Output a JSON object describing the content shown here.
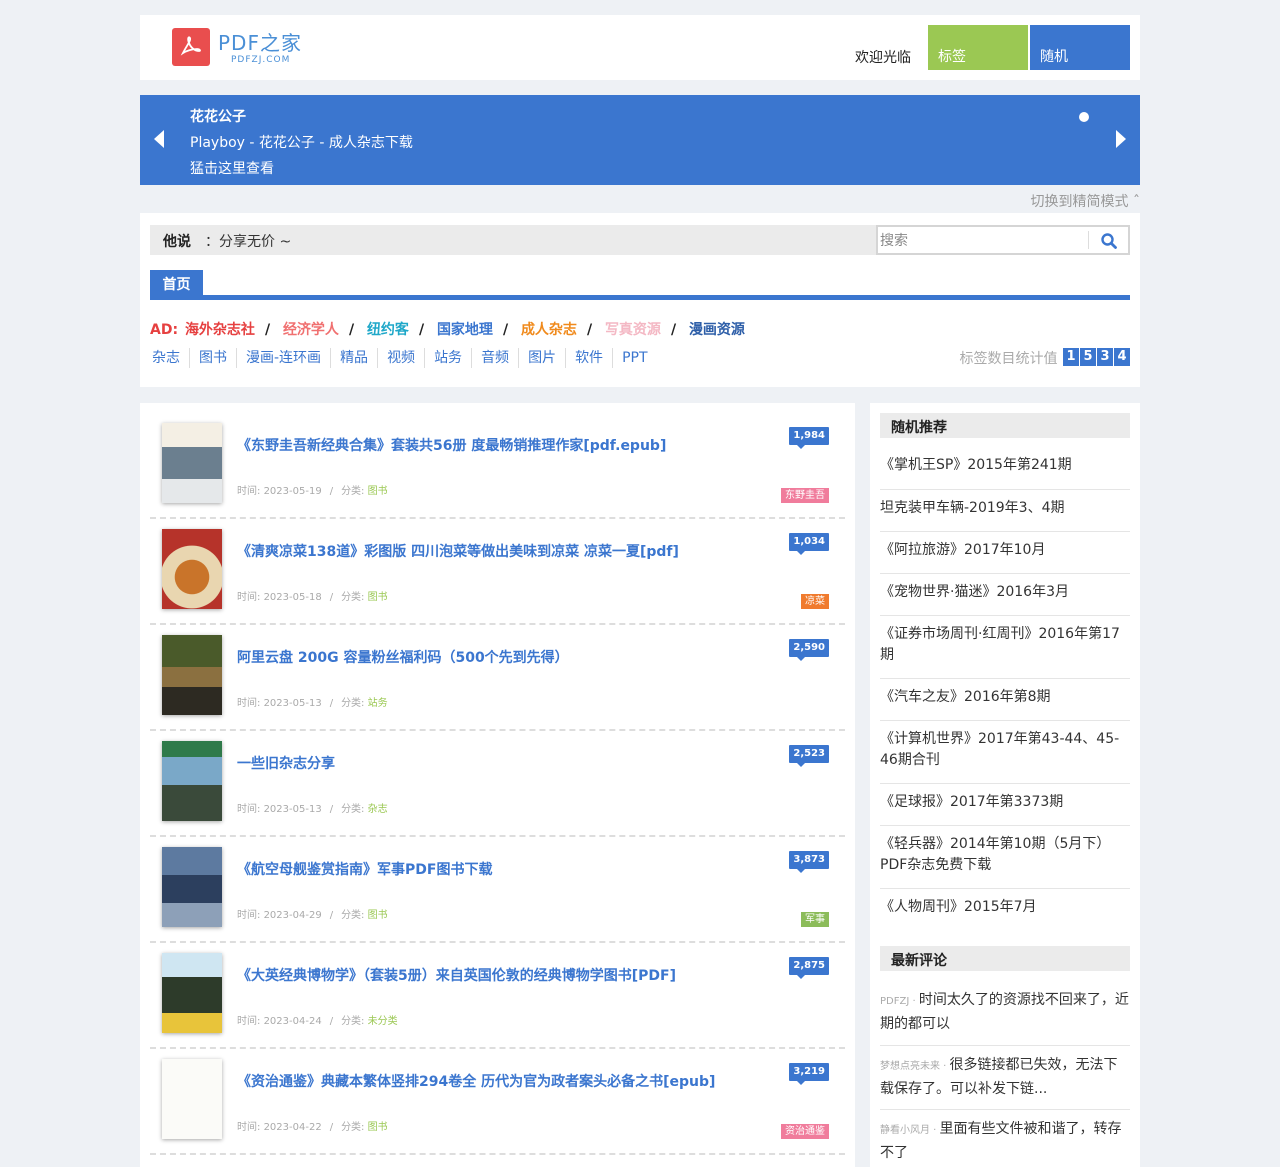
{
  "header": {
    "logo_text": "PDF之家",
    "logo_sub": "PDFZJ.COM",
    "welcome": "欢迎光临",
    "nav_tags": "标签",
    "nav_random": "随机"
  },
  "banner": {
    "title": "花花公子",
    "line2": "Playboy - 花花公子 - 成人杂志下载",
    "line3": "猛击这里查看"
  },
  "switch_mode": "切换到精简模式 ˆ",
  "say": {
    "label": "他说",
    "text": "：分享无价 ~"
  },
  "search": {
    "placeholder": "搜索"
  },
  "tab_home": "首页",
  "ad": {
    "prefix": "AD:",
    "items": [
      {
        "label": "海外杂志社",
        "color": "#e64040"
      },
      {
        "label": "经济学人",
        "color": "#f07070"
      },
      {
        "label": "纽约客",
        "color": "#1fa8c9"
      },
      {
        "label": "国家地理",
        "color": "#3b76cf"
      },
      {
        "label": "成人杂志",
        "color": "#f08a1c"
      },
      {
        "label": "写真资源",
        "color": "#f4b8c4"
      },
      {
        "label": "漫画资源",
        "color": "#2d5ea8"
      }
    ],
    "sep": "/"
  },
  "categories": [
    "杂志",
    "图书",
    "漫画-连环画",
    "精品",
    "视频",
    "站务",
    "音频",
    "图片",
    "软件",
    "PPT"
  ],
  "stat": {
    "label": "标签数目统计值",
    "digits": [
      "1",
      "5",
      "3",
      "4"
    ]
  },
  "articles": [
    {
      "title": "《东野圭吾新经典合集》套装共56册 度最畅销推理作家[pdf.epub]",
      "date": "2023-05-19",
      "category": "图书",
      "views": "1,984",
      "tag": "东野圭吾",
      "tag_color": "#f07c9c"
    },
    {
      "title": "《清爽凉菜138道》彩图版 四川泡菜等做出美味到凉菜 凉菜一夏[pdf]",
      "date": "2023-05-18",
      "category": "图书",
      "views": "1,034",
      "tag": "凉菜",
      "tag_color": "#f07b2e"
    },
    {
      "title": "阿里云盘 200G 容量粉丝福利码（500个先到先得）",
      "date": "2023-05-13",
      "category": "站务",
      "views": "2,590",
      "tag": "",
      "tag_color": ""
    },
    {
      "title": "一些旧杂志分享",
      "date": "2023-05-13",
      "category": "杂志",
      "views": "2,523",
      "tag": "",
      "tag_color": ""
    },
    {
      "title": "《航空母舰鉴赏指南》军事PDF图书下载",
      "date": "2023-04-29",
      "category": "图书",
      "views": "3,873",
      "tag": "军事",
      "tag_color": "#8cbc5a"
    },
    {
      "title": "《大英经典博物学》（套装5册）来自英国伦敦的经典博物学图书[PDF]",
      "date": "2023-04-24",
      "category": "未分类",
      "views": "2,875",
      "tag": "",
      "tag_color": ""
    },
    {
      "title": "《资治通鉴》典藏本繁体竖排294卷全 历代为官为政者案头必备之书[epub]",
      "date": "2023-04-22",
      "category": "图书",
      "views": "3,219",
      "tag": "资治通鉴",
      "tag_color": "#f07c9c"
    }
  ],
  "meta_labels": {
    "time": "时间: ",
    "cat": "分类: ",
    "sep": "/"
  },
  "sidebar": {
    "random_title": "随机推荐",
    "random": [
      "《掌机王SP》2015年第241期",
      "坦克装甲车辆-2019年3、4期",
      "《阿拉旅游》2017年10月",
      "《宠物世界·猫迷》2016年3月",
      "《证券市场周刊·红周刊》2016年第17期",
      "《汽车之友》2016年第8期",
      "《计算机世界》2017年第43-44、45-46期合刊",
      "《足球报》2017年第3373期",
      "《轻兵器》2014年第10期（5月下）PDF杂志免费下载",
      "《人物周刊》2015年7月"
    ],
    "comments_title": "最新评论",
    "comments": [
      {
        "user": "PDFZJ · ",
        "text": "时间太久了的资源找不回来了，近期的都可以"
      },
      {
        "user": "梦想点亮未来 · ",
        "text": "很多链接都已失效，无法下载保存了。可以补发下链..."
      },
      {
        "user": "静看小风月 · ",
        "text": "里面有些文件被和谐了，转存不了"
      }
    ]
  }
}
